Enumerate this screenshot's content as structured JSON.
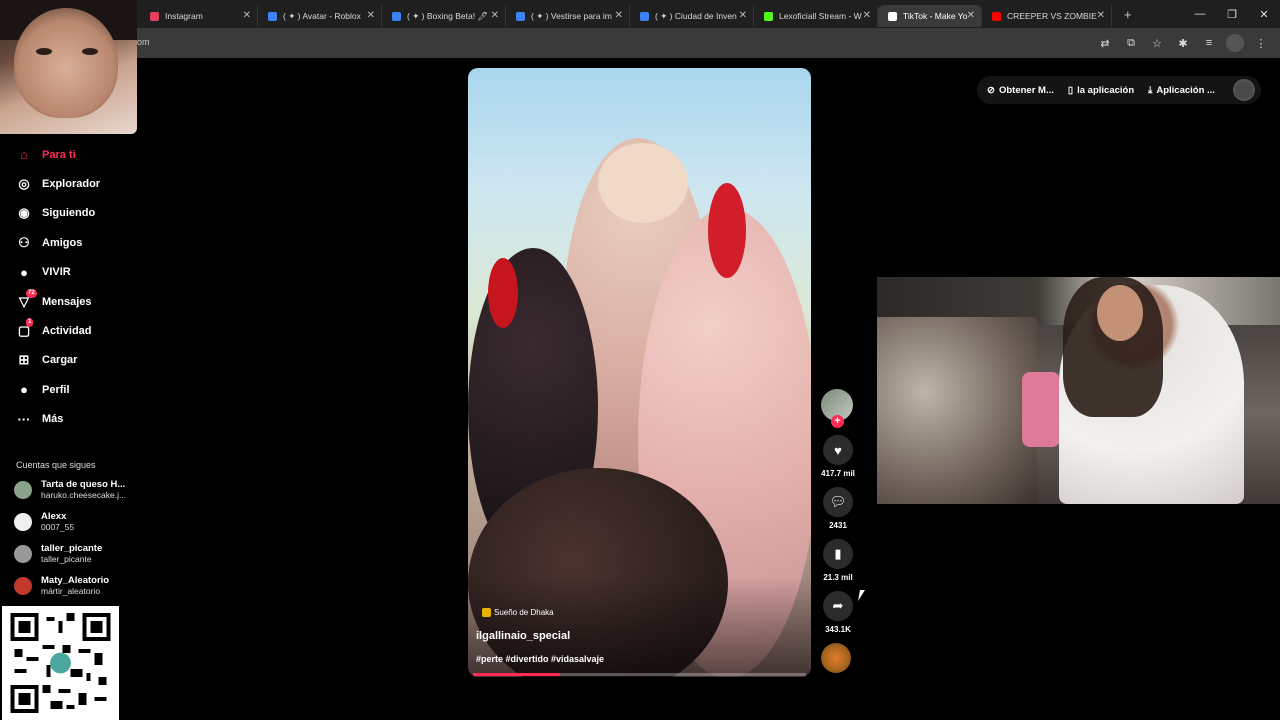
{
  "browser": {
    "tabs": [
      {
        "title": "",
        "color": "#e4405f"
      },
      {
        "title": "Instagram",
        "color": "#e4405f"
      },
      {
        "title": "( ✦ ) Avatar - Roblox",
        "color": "#3b82f6"
      },
      {
        "title": "( ✦ ) Boxing Beta! 🖊",
        "color": "#3b82f6"
      },
      {
        "title": "( ✦ ) Vestirse para im",
        "color": "#3b82f6"
      },
      {
        "title": "( ✦ ) Ciudad de Inven",
        "color": "#3b82f6"
      },
      {
        "title": "Lexoficiall Stream - W",
        "color": "#53fc18"
      },
      {
        "title": "TikTok - Make Yo",
        "color": "#ffffff"
      },
      {
        "title": "CREEPER VS ZOMBIE",
        "color": "#ff0000"
      }
    ],
    "active_tab": 7,
    "url_fragment": "om"
  },
  "sidebar": {
    "nav": [
      {
        "label": "Para ti",
        "icon": "home-icon",
        "glyph": "⌂",
        "active": true,
        "badge": ""
      },
      {
        "label": "Explorador",
        "icon": "compass-icon",
        "glyph": "◎",
        "active": false,
        "badge": ""
      },
      {
        "label": "Siguiendo",
        "icon": "following-icon",
        "glyph": "◉",
        "active": false,
        "badge": ""
      },
      {
        "label": "Amigos",
        "icon": "friends-icon",
        "glyph": "⚇",
        "active": false,
        "badge": ""
      },
      {
        "label": "VIVIR",
        "icon": "live-icon",
        "glyph": "●",
        "active": false,
        "badge": ""
      },
      {
        "label": "Mensajes",
        "icon": "messages-icon",
        "glyph": "▽",
        "active": false,
        "badge": "72"
      },
      {
        "label": "Actividad",
        "icon": "activity-icon",
        "glyph": "▢",
        "active": false,
        "badge": "1"
      },
      {
        "label": "Cargar",
        "icon": "upload-icon",
        "glyph": "⊞",
        "active": false,
        "badge": ""
      },
      {
        "label": "Perfil",
        "icon": "profile-icon",
        "glyph": "●",
        "active": false,
        "badge": ""
      },
      {
        "label": "Más",
        "icon": "more-icon",
        "glyph": "···",
        "active": false,
        "badge": ""
      }
    ],
    "following_title": "Cuentas que sigues",
    "following": [
      {
        "name": "Tarta de queso H...",
        "handle": "haruko.cheesecake.j..."
      },
      {
        "name": "Alexx",
        "handle": "0007_55"
      },
      {
        "name": "taller_picante",
        "handle": "taller_picante"
      },
      {
        "name": "Maty_Aleatorio",
        "handle": "mártir_aleatorio"
      }
    ]
  },
  "topbar": {
    "get_coins": "Obtener M...",
    "app": "la aplicación",
    "download": "Aplicación ..."
  },
  "video": {
    "music": "Sueño de Dhaka",
    "author": "ilgallinaio_special",
    "hashtags": "#perte #divertido #vidasalvaje",
    "progress": 0.26
  },
  "actions": {
    "likes": "417.7 mil",
    "comments": "2431",
    "saves": "21.3 mil",
    "shares": "343.1K"
  },
  "colors": {
    "accent": "#fe2c55"
  }
}
